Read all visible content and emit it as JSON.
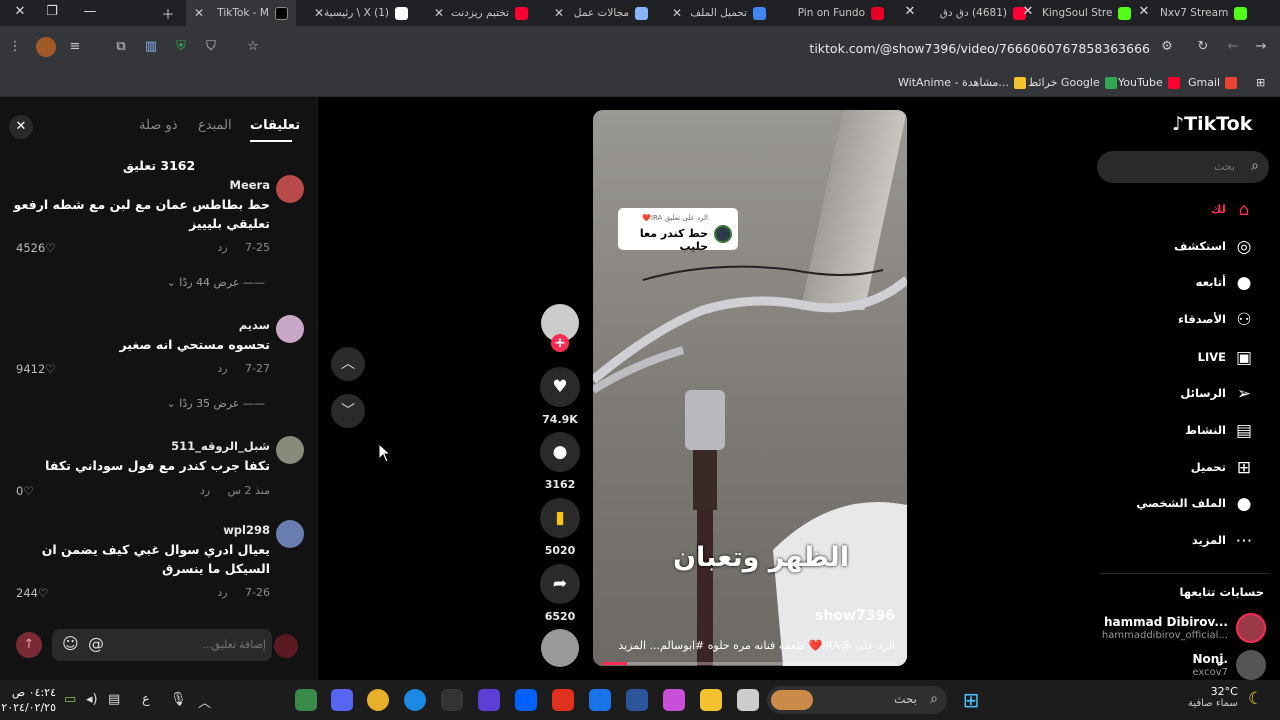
{
  "browser": {
    "tabs": [
      {
        "label": "Nxv7 Stream",
        "color": "#53fc18"
      },
      {
        "label": "KingSoul Stre",
        "color": "#53fc18"
      },
      {
        "label": "(4681) دق دق",
        "color": "#ff0033"
      },
      {
        "label": "Pin on Fundo",
        "color": "#e60023"
      },
      {
        "label": "تحميل الملف",
        "color": "#4285f4"
      },
      {
        "label": "مجالات عمل",
        "color": "#8ab4f8"
      },
      {
        "label": "تختيم ريزدنت",
        "color": "#ff0033"
      },
      {
        "label": "(1) X \\ رئيسية",
        "color": "#ffffff"
      },
      {
        "label": "TikTok - M",
        "color": "#000000"
      }
    ],
    "url": "tiktok.com/@show7396/video/7666060767858363666",
    "bookmarks": [
      {
        "label": "Gmail",
        "color": "#ea4335"
      },
      {
        "label": "YouTube",
        "color": "#ff0033"
      },
      {
        "label": "خرائط Google",
        "color": "#34a853"
      },
      {
        "label": "WitAnime - مشاهدة...",
        "color": "#f4c430"
      }
    ]
  },
  "comments_panel": {
    "tabs": {
      "comments": "تعليقات",
      "creator": "المبدع",
      "related": "ذو صلة"
    },
    "count": "3162 تعليق",
    "comments": [
      {
        "user": "Meera",
        "text": "حط بطاطس عمان مع لبن مع شطه ارفعو تعليقي بليييز",
        "date": "7-25",
        "reply": "رد",
        "likes": "4526",
        "view_replies": "عرض 44 ردًا",
        "avatar_color": "#b94a4a"
      },
      {
        "user": "سديم",
        "text": "تحسوه مستحي انه صغير",
        "date": "7-27",
        "reply": "رد",
        "likes": "9412",
        "view_replies": "عرض 35 ردًا",
        "avatar_color": "#c9a7c7"
      },
      {
        "user": "شبل_الروقه_511",
        "text": "تكفا جرب كندر مع فول سوداني تكفا",
        "date": "منذ 2 س",
        "reply": "رد",
        "likes": "0",
        "view_replies": "",
        "avatar_color": "#8a8a7a"
      },
      {
        "user": "wpl298",
        "text": "يعيال ادري سوال غبي كيف يضمن ان السيكل ما ينسرق",
        "date": "7-26",
        "reply": "رد",
        "likes": "244",
        "view_replies": "",
        "avatar_color": "#6a7db0"
      }
    ],
    "input_placeholder": "إضافة تعليق..."
  },
  "video": {
    "reply_small": "الرد على تعليق IRA❤️",
    "reply_text": "حط كندر معا حليب",
    "overlay_text": "الظهر وتعبان",
    "author": "show7396",
    "caption": "الرد على @IRA❤️ طعمه فنانه مره حلوه #ابوسالم... المزيد",
    "progress": 0.08
  },
  "actions": {
    "likes": "74.9K",
    "comments": "3162",
    "saves": "5020",
    "shares": "6520"
  },
  "sidebar": {
    "logo": "TikTok",
    "search_placeholder": "بحث",
    "nav": [
      {
        "label": "لك",
        "icon": "⌂",
        "color": "#fe2c55"
      },
      {
        "label": "استكشف",
        "icon": "◎",
        "color": "#ffffff"
      },
      {
        "label": "أتابعه",
        "icon": "●",
        "color": "#ffffff"
      },
      {
        "label": "الأصدقاء",
        "icon": "⚇",
        "color": "#ffffff"
      },
      {
        "label": "LIVE",
        "icon": "▣",
        "color": "#ffffff"
      },
      {
        "label": "الرسائل",
        "icon": "➢",
        "color": "#ffffff"
      },
      {
        "label": "النشاط",
        "icon": "▤",
        "color": "#ffffff"
      },
      {
        "label": "تحميل",
        "icon": "⊞",
        "color": "#ffffff"
      },
      {
        "label": "الملف الشخصي",
        "icon": "●",
        "color": "#ffffff"
      },
      {
        "label": "المزيد",
        "icon": "⋯",
        "color": "#ffffff"
      }
    ],
    "following_title": "حسابات تتابعها",
    "accounts": [
      {
        "name": "hammad Dibirov...",
        "handle": "hammaddibirov_official...",
        "badge": "LIVE"
      },
      {
        "name": "Non⁠ʝ.",
        "handle": "excov7",
        "badge": ""
      }
    ]
  },
  "taskbar": {
    "search_label": "بحث",
    "weather_temp": "32°C",
    "weather_desc": "سماء صافية",
    "time": "٠٤:٢٤ ص",
    "date": "٢٠٢٤/٠٢/٢٥",
    "lang": "ع"
  }
}
